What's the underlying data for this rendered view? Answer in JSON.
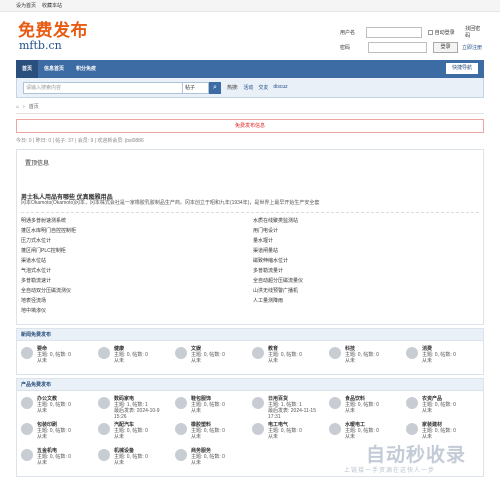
{
  "topbar": {
    "links": [
      "设为首页",
      "收藏本站"
    ]
  },
  "logo": {
    "top": "免费发布",
    "bottom": "mftb.cn"
  },
  "login": {
    "username_label": "用户名",
    "password_label": "密码",
    "remember_label": "自动登录",
    "forgot_label": "找回密码",
    "login_button": "登录",
    "register_label": "立即注册"
  },
  "nav": {
    "items": [
      "首页",
      "信息首页",
      "积分免疫"
    ],
    "quick": "快捷导航"
  },
  "search": {
    "placeholder": "请输入搜索内容",
    "select": "帖子",
    "go": "⌕",
    "hot_label": "热搜:",
    "hot": [
      "活动",
      "交友",
      "discuz"
    ]
  },
  "breadcrumb": {
    "home_icon": "home-icon",
    "sep": "›",
    "current": "首页"
  },
  "alert": "免费发布信息",
  "stats": "今日: 0 | 昨日: 0 | 帖子: 37 | 会员: 9 | 欢迎新会员: jbsl0886",
  "main": {
    "title": "置顶信息",
    "subtitle": "男士私人用品有哪些 优真图雅用品",
    "desc": "冈本Okamoto(Okamoto)冈本，冈本株式会社是一家橡胶乳胶制品生产商。冈本创立于昭和九年(1934年)，是世界上最早开始生产安全套",
    "list": [
      "明通多普射速测系统",
      "水质在线聚类监测站",
      "蓬区水库明门自控控制柜",
      "用门电设计",
      "压力式水位计",
      "量水堰计",
      "蓬区闸门PLC控制柜",
      "渠道闸量站",
      "渠道水位站",
      "磁致伸缩水位计",
      "气泡式水位计",
      "多普勒流量计",
      "多普勒流速计",
      "全自动超分压磁流量仪",
      "全自动双分压磁流测仪",
      "山洪无线预警广播机",
      "地表径流场",
      "人工量测降雨",
      "地中墒渗仪"
    ]
  },
  "sections": [
    {
      "title": "新闻免费发布",
      "forums": [
        {
          "name": "要命",
          "line1": "主题: 0, 帖数: 0",
          "line2": "从未"
        },
        {
          "name": "健康",
          "line1": "主题: 0, 帖数: 0",
          "line2": "从未"
        },
        {
          "name": "文娱",
          "line1": "主题: 0, 帖数: 0",
          "line2": "从未"
        },
        {
          "name": "教育",
          "line1": "主题: 0, 帖数: 0",
          "line2": "从未"
        },
        {
          "name": "科技",
          "line1": "主题: 0, 帖数: 0",
          "line2": "从未"
        },
        {
          "name": "消费",
          "line1": "主题: 0, 帖数: 0",
          "line2": "从未"
        }
      ]
    },
    {
      "title": "产品免费发布",
      "forums": [
        {
          "name": "办公文教",
          "line1": "主题: 0, 帖数: 0",
          "line2": "从未"
        },
        {
          "name": "数码家电",
          "line1": "主题: 1, 帖数: 1",
          "line2": "最后发表: 2024-10-9 15:26"
        },
        {
          "name": "鞋包服饰",
          "line1": "主题: 0, 帖数: 0",
          "line2": "从未"
        },
        {
          "name": "日用百货",
          "line1": "主题: 1, 帖数: 1",
          "line2": "最后发表: 2024-11-15 17:31"
        },
        {
          "name": "食品饮料",
          "line1": "主题: 0, 帖数: 0",
          "line2": "从未"
        },
        {
          "name": "农资产品",
          "line1": "主题: 0, 帖数: 0",
          "line2": "从未"
        },
        {
          "name": "包装印刷",
          "line1": "主题: 0, 帖数: 0",
          "line2": "从未"
        },
        {
          "name": "汽配汽车",
          "line1": "主题: 0, 帖数: 0",
          "line2": "从未"
        },
        {
          "name": "橡胶塑料",
          "line1": "主题: 0, 帖数: 0",
          "line2": "从未"
        },
        {
          "name": "电工电气",
          "line1": "主题: 0, 帖数: 0",
          "line2": "从未"
        },
        {
          "name": "水暖电工",
          "line1": "主题: 0, 帖数: 0",
          "line2": "从未"
        },
        {
          "name": "家装建材",
          "line1": "主题: 0, 帖数: 0",
          "line2": "从未"
        },
        {
          "name": "五金机电",
          "line1": "主题: 0, 帖数: 0",
          "line2": "从未"
        },
        {
          "name": "机械设备",
          "line1": "主题: 0, 帖数: 0",
          "line2": "从未"
        },
        {
          "name": "商务服务",
          "line1": "主题: 0, 帖数: 0",
          "line2": "从未"
        }
      ]
    }
  ],
  "watermark": {
    "big": "自动秒收录",
    "small": "上链接一手资源在这快人一步"
  },
  "colors": {
    "nav": "#3d6ba3",
    "logo": "#e85b13",
    "alert": "#e02020"
  }
}
